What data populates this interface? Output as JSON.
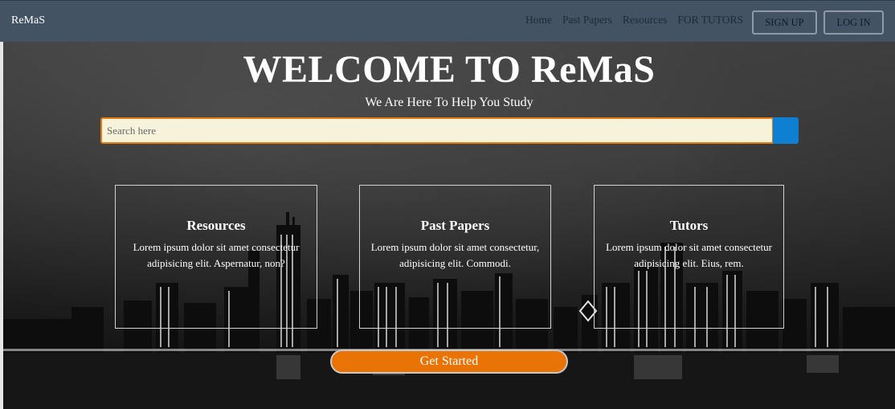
{
  "navbar": {
    "brand": "ReMaS",
    "links": [
      "Home",
      "Past Papers",
      "Resources",
      "FOR TUTORS"
    ],
    "signup_label": "SIGN UP",
    "login_label": "LOG IN"
  },
  "hero": {
    "title": "WELCOME TO ReMaS",
    "subtitle": "We Are Here To Help You Study",
    "search": {
      "placeholder": "Search here",
      "value": ""
    },
    "cards": [
      {
        "title": "Resources",
        "text": "Lorem ipsum dolor sit amet consectetur adipisicing elit. Aspernatur, non?"
      },
      {
        "title": "Past Papers",
        "text": "Lorem ipsum dolor sit amet consectetur, adipisicing elit. Commodi."
      },
      {
        "title": "Tutors",
        "text": "Lorem ipsum dolor sit amet consectetur adipisicing elit. Eius, rem."
      }
    ],
    "cta_label": "Get Started"
  },
  "colors": {
    "navbar_bg": "#435363",
    "accent_orange": "#ea7306",
    "search_button": "#0f7fd1",
    "search_bg": "#f6f3da"
  }
}
